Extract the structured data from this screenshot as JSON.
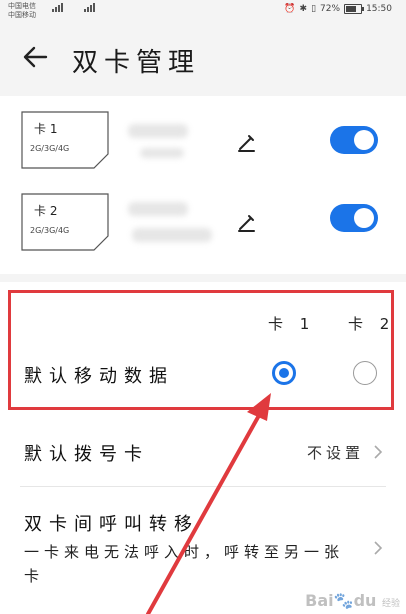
{
  "status_bar": {
    "carrier_1": "中国电信",
    "carrier_2": "中国移动",
    "battery_percent": "72%",
    "time": "15:50",
    "battery_level": 0.72
  },
  "header": {
    "title": "双卡管理",
    "back_icon": "arrow-left-icon"
  },
  "sim_cards": [
    {
      "label": "卡 1",
      "network": "2G/3G/4G",
      "enabled": true
    },
    {
      "label": "卡 2",
      "network": "2G/3G/4G",
      "enabled": true
    }
  ],
  "default_data": {
    "label": "默认移动数据",
    "col_1": "卡 1",
    "col_2": "卡 2",
    "selected": "卡 1"
  },
  "default_call": {
    "label": "默认拨号卡",
    "value": "不设置"
  },
  "call_forwarding": {
    "title": "双卡间呼叫转移",
    "description": "一卡来电无法呼入时，呼转至另一张卡"
  },
  "colors": {
    "accent": "#1b74e8",
    "annotation": "#e03a3e"
  },
  "watermark": {
    "brand": "Bai",
    "paw": "du",
    "suffix": "经验"
  }
}
